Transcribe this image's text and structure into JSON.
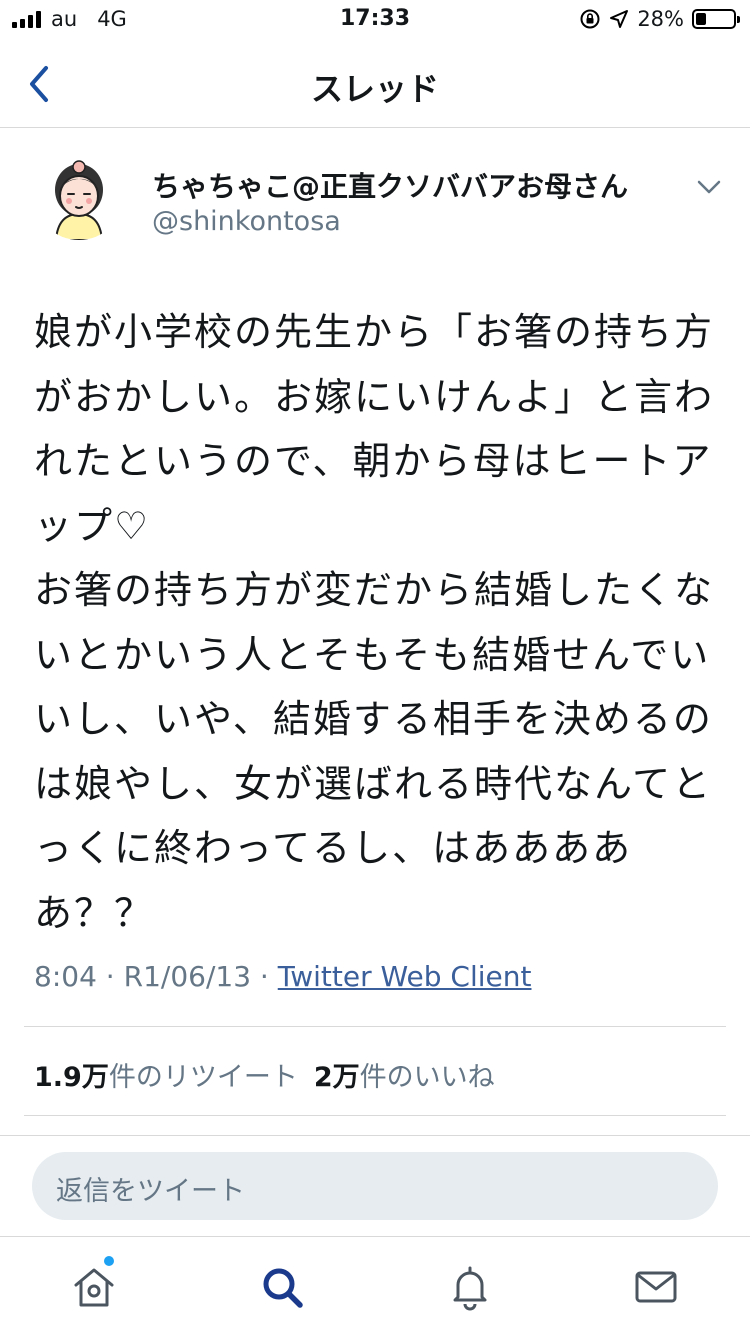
{
  "status_bar": {
    "carrier": "au",
    "network": "4G",
    "time": "17:33",
    "battery": "28%",
    "battery_level": 0.28
  },
  "nav": {
    "title": "スレッド",
    "back_icon": "chevron-left-icon"
  },
  "tweet": {
    "author_name": "ちゃちゃこ@正直クソババアお母さん",
    "author_handle": "@shinkontosa",
    "text": "娘が小学校の先生から「お箸の持ち方がおかしい。お嫁にいけんよ」と言われたというので、朝から母はヒートアップ♡\nお箸の持ち方が変だから結婚したくないとかいう人とそもそも結婚せんでいいし、いや、結婚する相手を決めるのは娘やし、女が選ばれる時代なんてとっくに終わってるし、はあああああ？？",
    "time": "8:04",
    "date": "R1/06/13",
    "separator": "·",
    "client": "Twitter Web Client",
    "retweet_count": "1.9万",
    "retweet_label": "件のリツイート",
    "like_count": "2万",
    "like_label": "件のいいね"
  },
  "reply": {
    "placeholder": "返信をツイート"
  },
  "tabs": [
    {
      "name": "home-icon",
      "has_badge": true
    },
    {
      "name": "search-icon",
      "active": true
    },
    {
      "name": "bell-icon"
    },
    {
      "name": "mail-icon"
    }
  ],
  "colors": {
    "text": "#14171a",
    "secondary": "#657786",
    "link": "#3a5f9a",
    "accent": "#1da1f2",
    "active_tab": "#1b3a8c",
    "reply_bg": "#e6ecf0"
  }
}
